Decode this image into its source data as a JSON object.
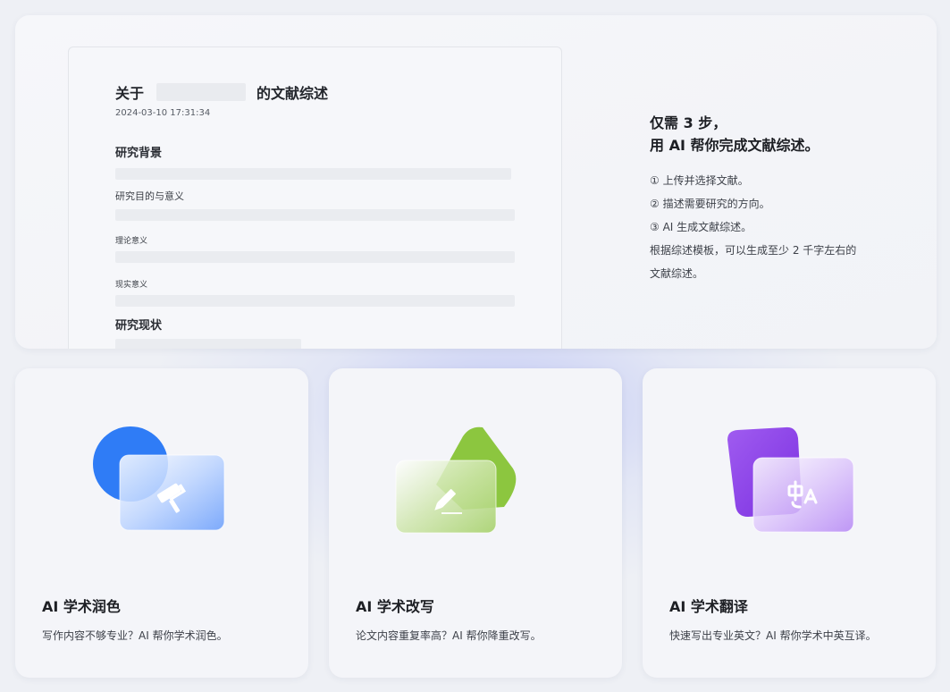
{
  "document_preview": {
    "title_prefix": "关于",
    "title_suffix": "的文献综述",
    "date": "2024-03-10 17:31:34",
    "section_background": "研究背景",
    "purpose_label": "研究目的与意义",
    "theory_label": "理论意义",
    "practical_label": "现实意义",
    "section_status": "研究现状"
  },
  "intro": {
    "title_line1": "仅需 3 步，",
    "title_line2": "用 AI 帮你完成文献综述。",
    "step1": "① 上传并选择文献。",
    "step2": "② 描述需要研究的方向。",
    "step3": "③ AI 生成文献综述。",
    "note_line1": "根据综述模板，可以生成至少 2 千字左右的",
    "note_line2": "文献综述。"
  },
  "features": [
    {
      "title": "AI 学术润色",
      "desc": "写作内容不够专业？AI 帮你学术润色。",
      "icon": "paint-roller-icon",
      "accent": "#2f7cf6"
    },
    {
      "title": "AI 学术改写",
      "desc": "论文内容重复率高？AI 帮你降重改写。",
      "icon": "pencil-icon",
      "accent": "#8cc63f"
    },
    {
      "title": "AI 学术翻译",
      "desc": "快速写出专业英文？AI 帮你学术中英互译。",
      "icon": "translate-icon",
      "accent": "#8e3fe6"
    }
  ]
}
